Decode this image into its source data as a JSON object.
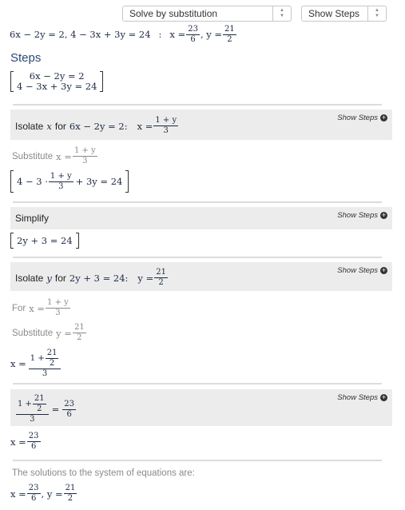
{
  "toolbar": {
    "method_select": "Solve by substitution",
    "steps_select": "Show Steps"
  },
  "problem": {
    "equations": "6x − 2y = 2, 4 − 3x + 3y = 24",
    "colon": ":",
    "solution_prefix": "x =",
    "x_num": "23",
    "x_den": "6",
    "sep": ", y =",
    "y_num": "21",
    "y_den": "2"
  },
  "steps_heading": "Steps",
  "system": {
    "eq1": "6x − 2y = 2",
    "eq2": "4 − 3x + 3y = 24"
  },
  "show_steps_label": "Show Steps",
  "step1": {
    "title_prefix": "Isolate",
    "var": "x",
    "title_for": "for",
    "title_eq": "6x − 2y = 2:",
    "result_prefix": "x =",
    "num": "1 + y",
    "den": "3"
  },
  "step1_sub": {
    "label": "Substitute",
    "expr_prefix": "x =",
    "num": "1 + y",
    "den": "3"
  },
  "step1_eq": {
    "prefix": "4 − 3 ·",
    "num": "1 + y",
    "den": "3",
    "suffix": "+ 3y = 24"
  },
  "step2": {
    "title": "Simplify",
    "result": "2y + 3 = 24"
  },
  "step3": {
    "title_prefix": "Isolate",
    "var": "y",
    "title_for": "for",
    "title_eq": "2y + 3 = 24:",
    "result_prefix": "y =",
    "num": "21",
    "den": "2"
  },
  "for_x": {
    "label": "For",
    "expr_prefix": "x =",
    "num": "1 + y",
    "den": "3"
  },
  "sub_y": {
    "label": "Substitute",
    "expr_prefix": "y =",
    "num": "21",
    "den": "2"
  },
  "x_expr": {
    "prefix": "x =",
    "num_lead": "1 +",
    "inner_num": "21",
    "inner_den": "2",
    "den": "3"
  },
  "step4": {
    "num_lead": "1 +",
    "inner_num": "21",
    "inner_den": "2",
    "den": "3",
    "eq": "=",
    "r_num": "23",
    "r_den": "6"
  },
  "x_result": {
    "prefix": "x =",
    "num": "23",
    "den": "6"
  },
  "final": {
    "label": "The solutions to the system of equations are:",
    "prefix": "x =",
    "x_num": "23",
    "x_den": "6",
    "sep": ", y =",
    "y_num": "21",
    "y_den": "2"
  }
}
